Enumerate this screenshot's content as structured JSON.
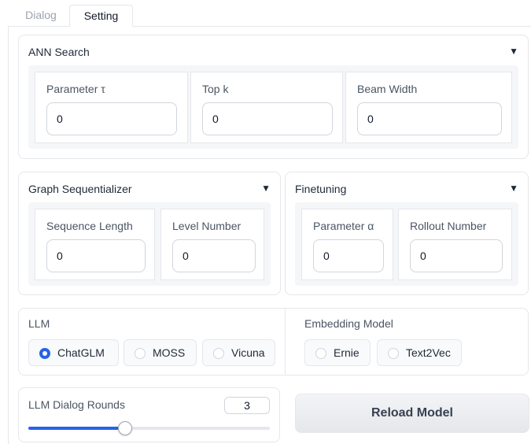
{
  "tabs": [
    {
      "label": "Dialog",
      "selected": false
    },
    {
      "label": "Setting",
      "selected": true
    }
  ],
  "ann_search": {
    "title": "ANN Search",
    "toggle_icon": "caret-down-icon",
    "fields": [
      {
        "label": "Parameter τ",
        "value": "0"
      },
      {
        "label": "Top k",
        "value": "0"
      },
      {
        "label": "Beam Width",
        "value": "0"
      }
    ]
  },
  "graph_sequentializer": {
    "title": "Graph Sequentializer",
    "fields": [
      {
        "label": "Sequence Length",
        "value": "0"
      },
      {
        "label": "Level Number",
        "value": "0"
      }
    ]
  },
  "finetuning": {
    "title": "Finetuning",
    "fields": [
      {
        "label": "Parameter α",
        "value": "0"
      },
      {
        "label": "Rollout Number",
        "value": "0"
      }
    ]
  },
  "llm": {
    "label": "LLM",
    "options": [
      "ChatGLM",
      "MOSS",
      "Vicuna"
    ],
    "selected": "ChatGLM"
  },
  "embedding_model": {
    "label": "Embedding Model",
    "options": [
      "Ernie",
      "Text2Vec"
    ],
    "selected": null
  },
  "dialog_rounds": {
    "label": "LLM Dialog Rounds",
    "value": "3",
    "slider_fraction": 0.4
  },
  "reload_button": {
    "label": "Reload Model"
  },
  "colors": {
    "accent": "#2563eb",
    "border": "#e5e7eb",
    "panel_body": "#f5f6f8"
  }
}
